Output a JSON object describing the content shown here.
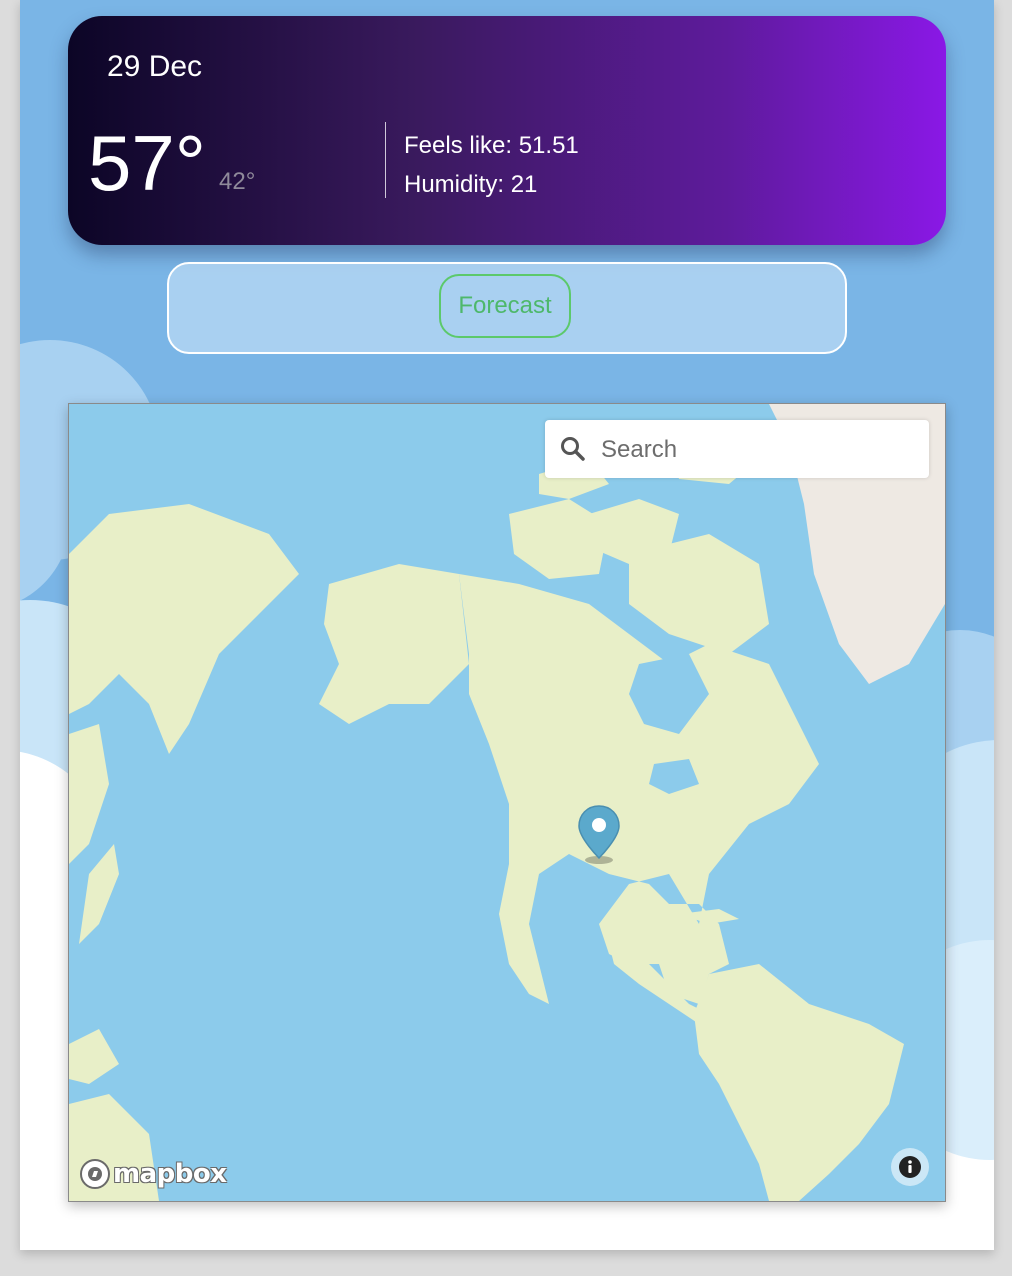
{
  "weather": {
    "date": "29 Dec",
    "temperature": "57°",
    "low_temperature": "42°",
    "feels_like": "Feels like: 51.51",
    "humidity": "Humidity: 21"
  },
  "forecast": {
    "button_label": "Forecast"
  },
  "map": {
    "search": {
      "placeholder": "Search",
      "value": ""
    },
    "attribution_logo": "mapbox",
    "info_icon": "info-icon",
    "marker_icon": "map-pin-icon"
  },
  "colors": {
    "card_gradient_start": "#0c0526",
    "card_gradient_end": "#8a18e6",
    "sky": "#7ab5e6",
    "accent_green": "#5cc96b",
    "water": "#8ccbeb",
    "land": "#e8efc8",
    "pin": "#5ba9cc"
  }
}
